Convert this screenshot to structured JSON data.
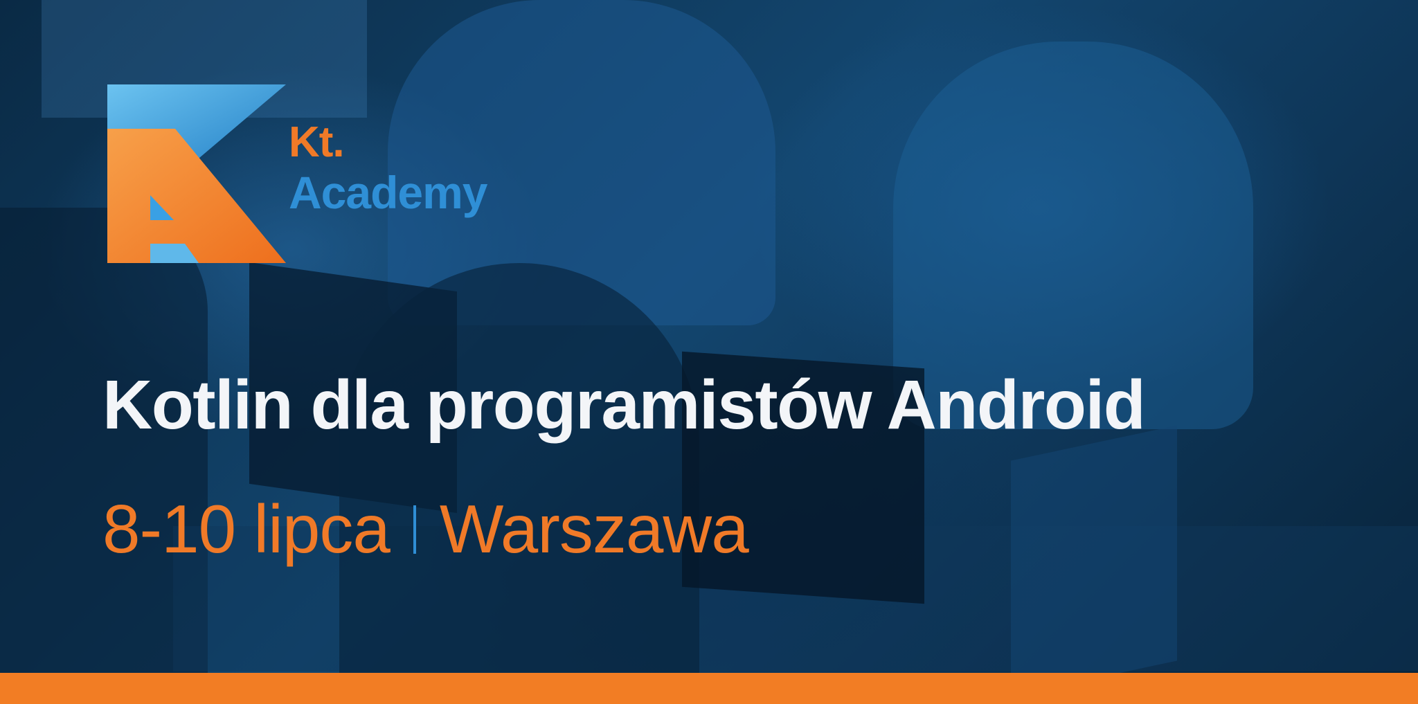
{
  "brand": {
    "name_line1": "Kt.",
    "name_line2": "Academy",
    "logo_icon": "kt-academy-logo-icon",
    "colors": {
      "orange": "#f07a28",
      "blue": "#2f8fd6",
      "light_blue": "#62b8ec"
    }
  },
  "event": {
    "title": "Kotlin dla programistów Android",
    "dates": "8-10 lipca",
    "city": "Warszawa"
  },
  "colors": {
    "bar": "#f27d24",
    "title": "#f3f5f8",
    "overlay": "#13466f"
  }
}
